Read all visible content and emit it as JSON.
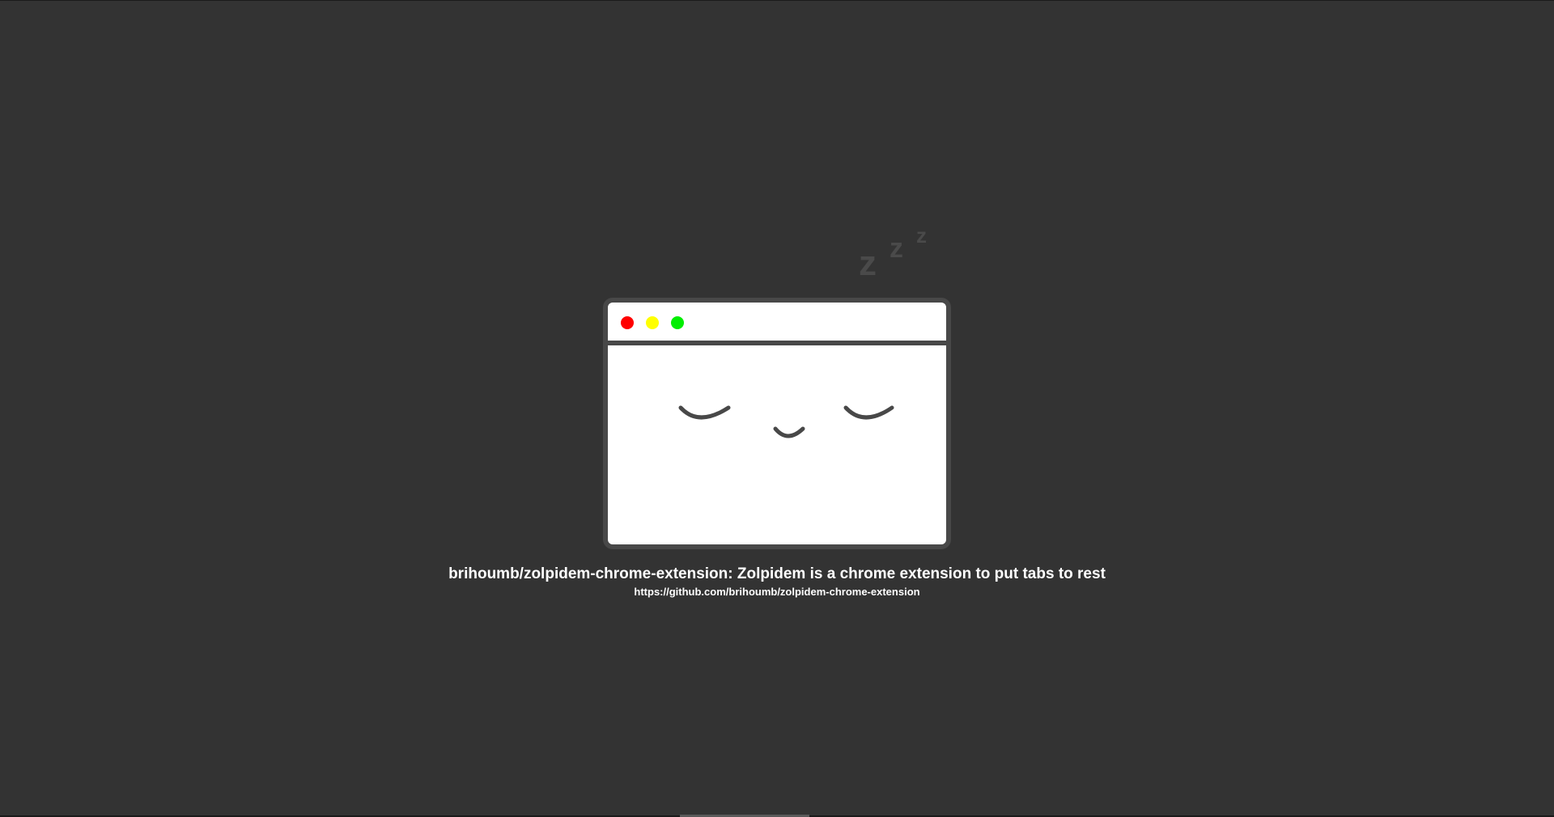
{
  "page": {
    "title": "brihoumb/zolpidem-chrome-extension: Zolpidem is a chrome extension to put tabs to rest",
    "url": "https://github.com/brihoumb/zolpidem-chrome-extension"
  },
  "illustration": {
    "zzz": [
      "z",
      "z",
      "z"
    ],
    "window_buttons": [
      {
        "name": "close-dot-icon",
        "color": "#ff0000"
      },
      {
        "name": "minimize-dot-icon",
        "color": "#ffff00"
      },
      {
        "name": "maximize-dot-icon",
        "color": "#00ee00"
      }
    ],
    "frame_color": "#484848",
    "face": "sleeping-face-icon"
  },
  "colors": {
    "background": "#333333",
    "text": "#ffffff",
    "zzz": "#4a4a4a"
  }
}
